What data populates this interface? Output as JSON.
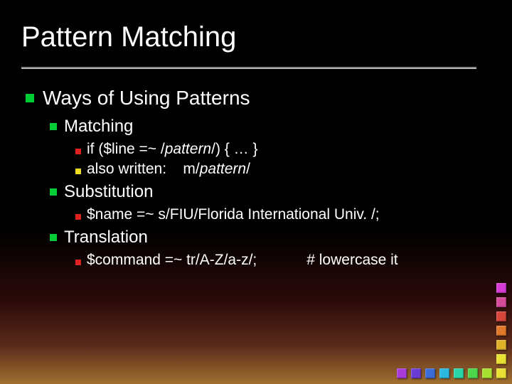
{
  "title": "Pattern Matching",
  "lvl1": {
    "text": "Ways of Using Patterns"
  },
  "sections": [
    {
      "heading": "Matching",
      "items": [
        {
          "pre": "if ($line =~ /",
          "it": "pattern",
          "post": "/)  { … }"
        },
        {
          "pre": "also written:    m/",
          "it": "pattern",
          "post": "/"
        }
      ]
    },
    {
      "heading": "Substitution",
      "items": [
        {
          "pre": "$name =~ s/FIU/Florida International Univ. /;",
          "it": "",
          "post": ""
        }
      ]
    },
    {
      "heading": "Translation",
      "items": [
        {
          "pre": "$command =~ tr/A-Z/a-z/;",
          "it": "",
          "post": "",
          "comment": "# lowercase it"
        }
      ]
    }
  ]
}
